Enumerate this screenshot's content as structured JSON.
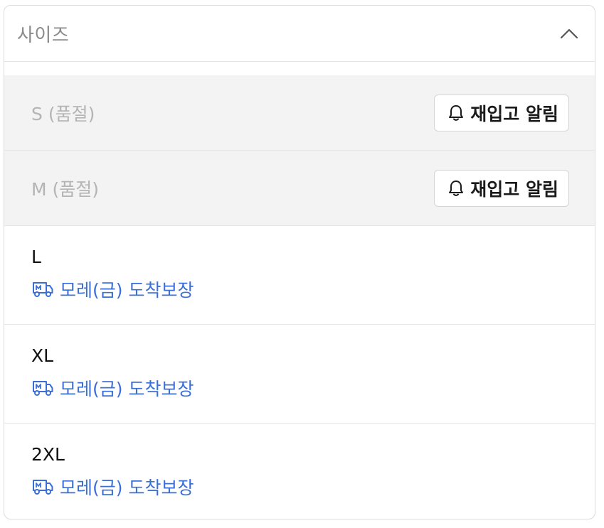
{
  "dropdown": {
    "title": "사이즈",
    "expanded": true,
    "options": [
      {
        "label": "S (품절)",
        "soldout": true,
        "action_label": "재입고 알림"
      },
      {
        "label": "M (품절)",
        "soldout": true,
        "action_label": "재입고 알림"
      },
      {
        "label": "L",
        "soldout": false,
        "delivery": "모레(금) 도착보장"
      },
      {
        "label": "XL",
        "soldout": false,
        "delivery": "모레(금) 도착보장"
      },
      {
        "label": "2XL",
        "soldout": false,
        "delivery": "모레(금) 도착보장"
      }
    ]
  },
  "icons": {
    "header": "chevron-up-icon",
    "restock": "bell-icon",
    "delivery": "delivery-truck-icon"
  },
  "colors": {
    "delivery_text": "#3b6fd6",
    "soldout_bg": "#f3f3f3",
    "soldout_text": "#b4b4b4"
  }
}
